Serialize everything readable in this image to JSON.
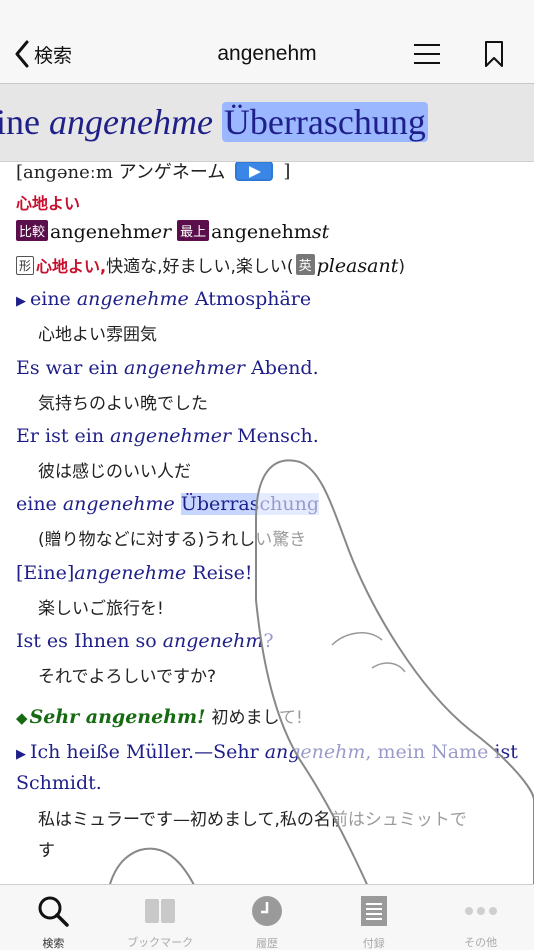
{
  "nav": {
    "back_label": "検索",
    "title": "angenehm"
  },
  "magnifier": {
    "pre": "ine ",
    "italic": "angenehme",
    "highlight": "Überraschung"
  },
  "entry": {
    "pronunciation_left": "[angəneːm アンゲネーム",
    "pronunciation_right": "]",
    "headword_meaning": "心地よい",
    "comparative_tag": "比較",
    "comparative_stem": "angenehm",
    "comparative_suffix": "er",
    "superlative_tag": "最上",
    "superlative_stem": "angenehm",
    "superlative_suffix": "st",
    "pos_tag": "形",
    "meaning_bold": "心地よい,",
    "meaning_rest": "快適な,好ましい,楽しい(",
    "english_tag": "英",
    "english_word": "pleasant",
    "meaning_close": ")",
    "examples": [
      {
        "pre": "eine ",
        "italic": "angenehme",
        "post": " Atmosphäre",
        "jp": "心地よい雰囲気"
      },
      {
        "pre": "Es war ein ",
        "italic": "angenehmer",
        "post": " Abend.",
        "jp": "気持ちのよい晩でした"
      },
      {
        "pre": "Er ist ein ",
        "italic": "angenehmer",
        "post": " Mensch.",
        "jp": "彼は感じのいい人だ"
      },
      {
        "pre": "eine ",
        "italic": "angenehme",
        "post": "Überraschung",
        "jp": "(贈り物などに対する)うれしい驚き"
      },
      {
        "pre": "[Eine]",
        "italic": "angenehme",
        "post": " Reise!",
        "jp": "楽しいご旅行を!"
      },
      {
        "pre": "Ist es Ihnen so ",
        "italic": "angenehm",
        "post": "?",
        "jp": "それでよろしいですか?"
      }
    ],
    "idiom_phrase": "Sehr angenehm!",
    "idiom_meaning": "初めまして!",
    "idiom_example_pre": "Ich heiße Müller.—Sehr ",
    "idiom_example_italic": "angenehm",
    "idiom_example_post": ", mein Name ist",
    "idiom_example_line2": "Schmidt.",
    "idiom_jp_line1": "私はミュラーです—初めまして,私の名前はシュミットで",
    "idiom_jp_line2": "す"
  },
  "tabs": [
    {
      "label": "検索",
      "icon": "search-icon"
    },
    {
      "label": "ブックマーク",
      "icon": "book-icon"
    },
    {
      "label": "履歴",
      "icon": "clock-icon"
    },
    {
      "label": "付録",
      "icon": "document-icon"
    },
    {
      "label": "その他",
      "icon": "more-icon"
    }
  ],
  "colors": {
    "german_text": "#1f1f8a",
    "headword_red": "#c8102e",
    "tag_purple": "#5a0f4c",
    "idiom_green": "#156a12",
    "highlight": "#9bb7ff"
  }
}
